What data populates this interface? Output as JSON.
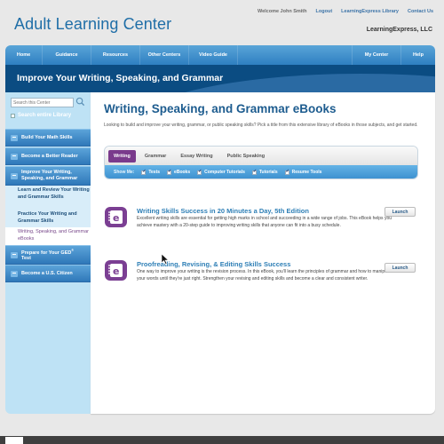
{
  "header": {
    "site_title": "Adult Learning Center",
    "welcome": "Welcome John Smith",
    "links": [
      "Logout",
      "LearningExpress Library",
      "Contact Us"
    ],
    "company": "LearningExpress, LLC"
  },
  "nav": {
    "left": [
      "Home",
      "Guidance",
      "Resources",
      "Other Centers",
      "Video Guide"
    ],
    "right": [
      "My Center",
      "Help"
    ]
  },
  "banner": {
    "title": "Improve Your Writing, Speaking, and Grammar"
  },
  "sidebar": {
    "search_placeholder": "Search this Center",
    "search_library_label": "Search entire Library",
    "sections": [
      {
        "label": "Build Your Math Skills"
      },
      {
        "label": "Become a Better Reader"
      },
      {
        "label": "Improve Your Writing, Speaking, and Grammar"
      },
      {
        "label_main": "Prepare for Your GED",
        "label_sup": "®",
        "label_tail": " Test"
      },
      {
        "label": "Become a U.S. Citizen"
      }
    ],
    "sub_items": [
      {
        "label": "Learn and Review Your Writing and Grammar Skills"
      },
      {
        "label": "Practice Your Writing and Grammar Skills"
      },
      {
        "label": "Writing, Speaking, and Grammar eBooks",
        "active": true
      }
    ]
  },
  "main": {
    "heading": "Writing, Speaking, and Grammar eBooks",
    "intro": "Looking to build and improve your writing, grammar, or public speaking skills? Pick a title from this extensive library of eBooks in those subjects, and get started.",
    "tabs": [
      {
        "label": "Writing",
        "active": true
      },
      {
        "label": "Grammar"
      },
      {
        "label": "Essay Writing"
      },
      {
        "label": "Public Speaking"
      }
    ],
    "filter_label": "Show Me:",
    "filters": [
      {
        "label": "Tests",
        "checked": true
      },
      {
        "label": "eBooks",
        "checked": true
      },
      {
        "label": "Computer Tutorials",
        "checked": true
      },
      {
        "label": "Tutorials",
        "checked": true
      },
      {
        "label": "Resume Tools",
        "checked": true
      }
    ],
    "items": [
      {
        "icon": "ebook-icon",
        "title": "Writing Skills Success in 20 Minutes a Day, 5th Edition",
        "description": "Excellent writing skills are essential for getting high marks in school and succeeding in a wide range of jobs. This eBook helps you achieve mastery with a 20-step guide to improving writing skills that anyone can fit into a busy schedule.",
        "button": "Launch"
      },
      {
        "icon": "ebook-icon",
        "title": "Proofreading, Revising, & Editing Skills Success",
        "description": "One way to improve your writing is the revision process. In this eBook, you'll learn the principles of grammar and how to manipulate your words until they're just right. Strengthen your revising and editing skills and become a clear and consistent writer.",
        "button": "Launch"
      }
    ]
  },
  "colors": {
    "brand_blue": "#1f6ea7",
    "banner": "#0b4c82",
    "accent_purple": "#7a3a8c",
    "sidebar_bg": "#bee2f5"
  }
}
